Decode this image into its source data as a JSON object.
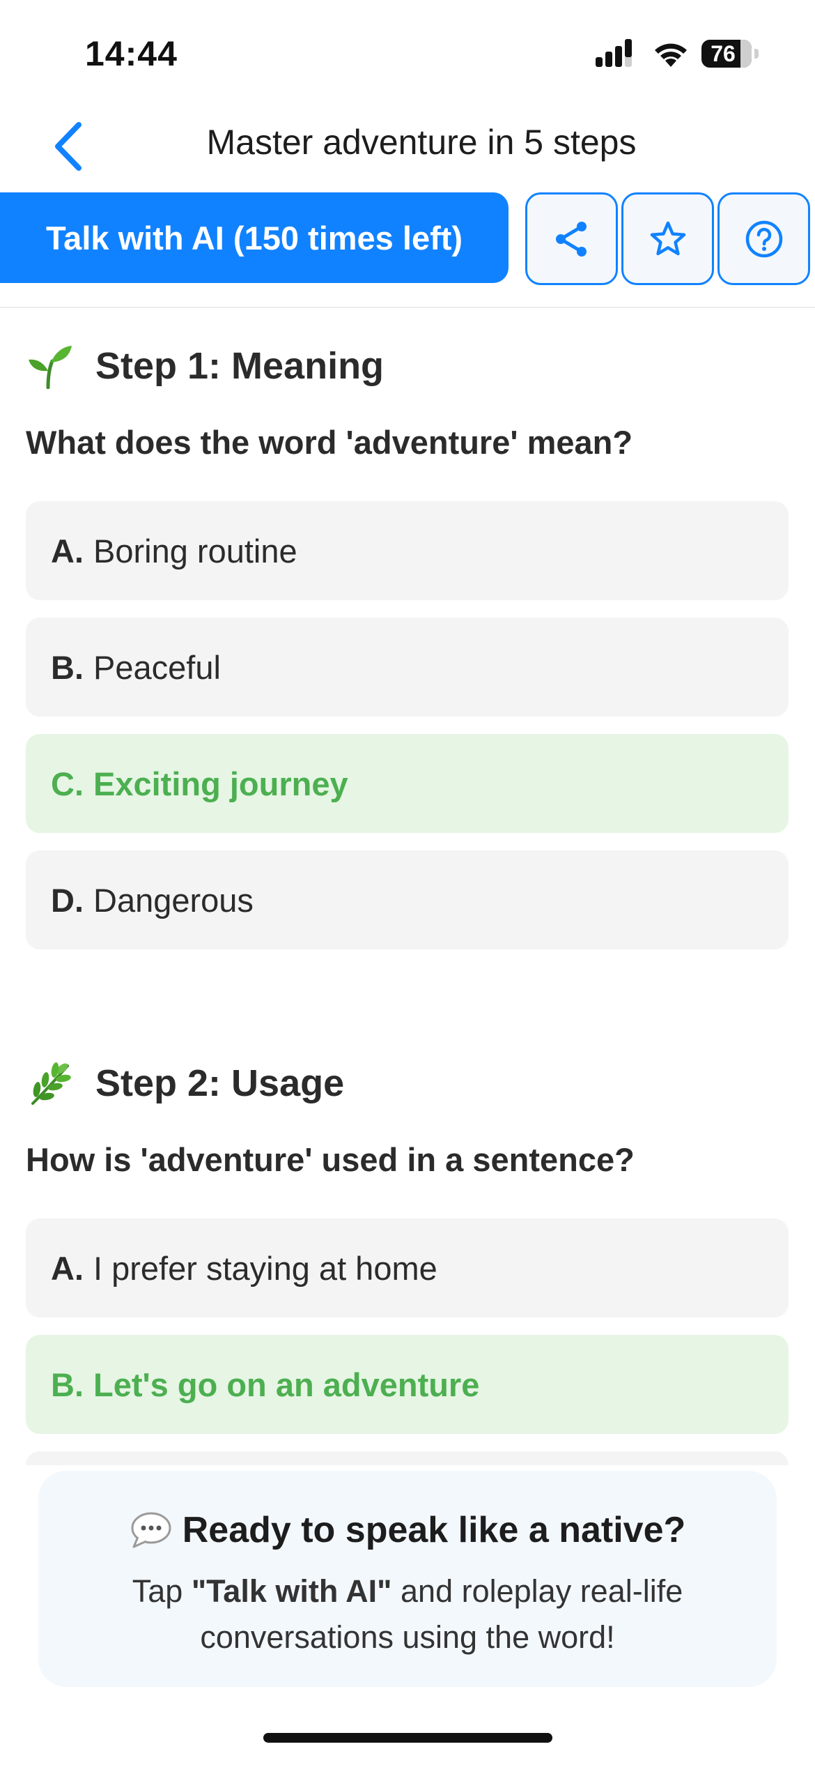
{
  "status_bar": {
    "time": "14:44",
    "battery_level": "76"
  },
  "nav": {
    "title": "Master adventure in 5 steps"
  },
  "toolbar": {
    "talk_button_label": "Talk with AI (150 times left)"
  },
  "steps": [
    {
      "title": "Step 1: Meaning",
      "question": "What does the word 'adventure' mean?",
      "options": [
        {
          "letter": "A.",
          "text": "Boring routine",
          "correct": false
        },
        {
          "letter": "B.",
          "text": "Peaceful",
          "correct": false
        },
        {
          "letter": "C.",
          "text": "Exciting journey",
          "correct": true
        },
        {
          "letter": "D.",
          "text": "Dangerous",
          "correct": false
        }
      ]
    },
    {
      "title": "Step 2: Usage",
      "question": "How is 'adventure' used in a sentence?",
      "options": [
        {
          "letter": "A.",
          "text": "I prefer staying at home",
          "correct": false
        },
        {
          "letter": "B.",
          "text": "Let's go on an adventure",
          "correct": true
        }
      ]
    }
  ],
  "cta": {
    "title": "Ready to speak like a native?",
    "body_prefix": "Tap ",
    "body_highlight": "\"Talk with AI\"",
    "body_suffix": " and roleplay real-life conversations using the word!"
  },
  "colors": {
    "accent": "#1182ff",
    "correct_text": "#4caf50",
    "correct_bg": "#e6f5e4",
    "option_bg": "#f4f4f4"
  },
  "icons": [
    "back-chevron-icon",
    "share-icon",
    "star-icon",
    "help-icon",
    "seedling-icon",
    "herb-icon",
    "speech-bubble-icon"
  ]
}
